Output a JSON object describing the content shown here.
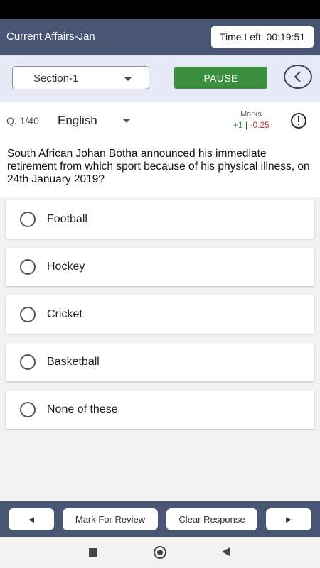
{
  "header": {
    "title": "Current Affairs-Jan",
    "time_left": "Time Left: 00:19:51"
  },
  "toolbar": {
    "section": "Section-1",
    "pause_label": "PAUSE",
    "back_icon": "chevron-left-icon"
  },
  "question_meta": {
    "number": "Q. 1/40",
    "language": "English",
    "marks_title": "Marks",
    "marks_positive": "+1",
    "marks_separator": "|",
    "marks_negative": "-0.25",
    "info_icon": "exclamation-circle-icon"
  },
  "question": {
    "text": "South African Johan Botha announced his immediate retirement from which sport because of his physical illness, on 24th January 2019?"
  },
  "options": [
    {
      "label": "Football",
      "selected": false
    },
    {
      "label": "Hockey",
      "selected": false
    },
    {
      "label": "Cricket",
      "selected": false
    },
    {
      "label": "Basketball",
      "selected": false
    },
    {
      "label": "None of these",
      "selected": false
    }
  ],
  "bottom_nav": {
    "prev_label": "◄",
    "mark_review_label": "Mark For Review",
    "clear_label": "Clear Response",
    "next_label": "►"
  },
  "colors": {
    "header_bg": "#485573",
    "section_bg": "#e7e9f6",
    "pause_bg": "#3d8f40",
    "positive": "#2e9e45",
    "negative": "#d03a3a"
  }
}
